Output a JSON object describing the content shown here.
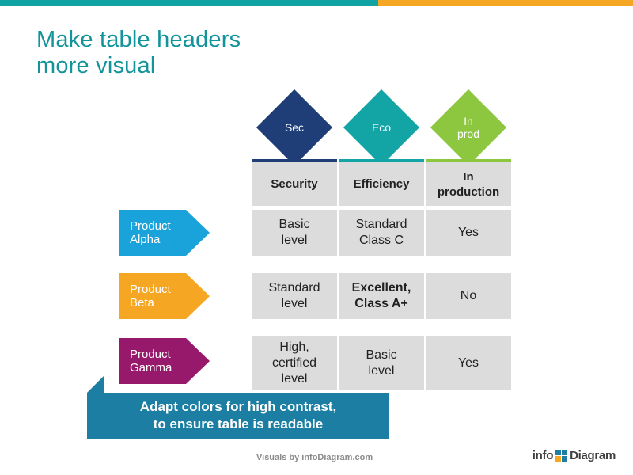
{
  "slide": {
    "title": "Make table headers\nmore visual",
    "accent_teal": "#11a2a4",
    "accent_orange": "#f5a623"
  },
  "header_icons": [
    {
      "label": "Sec",
      "color": "#1f3e78"
    },
    {
      "label": "Eco",
      "color": "#13a4a6"
    },
    {
      "label": "In\nprod",
      "color": "#8dc63f"
    }
  ],
  "table": {
    "columns": [
      {
        "header": "Security",
        "accent": "#1f3e78"
      },
      {
        "header": "Efficiency",
        "accent": "#13a4a6"
      },
      {
        "header": "In\nproduction",
        "accent": "#8dc63f"
      }
    ],
    "rows": [
      {
        "label": "Product Alpha",
        "label_color": "#1aa3db",
        "cells": [
          {
            "text": "Basic\nlevel",
            "bold": false
          },
          {
            "text": "Standard\nClass C",
            "bold": false
          },
          {
            "text": "Yes",
            "bold": false
          }
        ]
      },
      {
        "label": "Product Beta",
        "label_color": "#f5a623",
        "cells": [
          {
            "text": "Standard\nlevel",
            "bold": false
          },
          {
            "text": "Excellent,\nClass A+",
            "bold": true
          },
          {
            "text": "No",
            "bold": false
          }
        ]
      },
      {
        "label": "Product Gamma",
        "label_color": "#97196b",
        "cells": [
          {
            "text": "High,\ncertified\nlevel",
            "bold": false
          },
          {
            "text": "Basic\nlevel",
            "bold": false
          },
          {
            "text": "Yes",
            "bold": false
          }
        ]
      }
    ]
  },
  "banner": {
    "text": "Adapt colors for high contrast,\nto ensure table is readable",
    "color": "#1b7ea2"
  },
  "footer": {
    "credit": "Visuals by infoDiagram.com",
    "logo_part1": "info",
    "logo_part2": "Diagram"
  }
}
